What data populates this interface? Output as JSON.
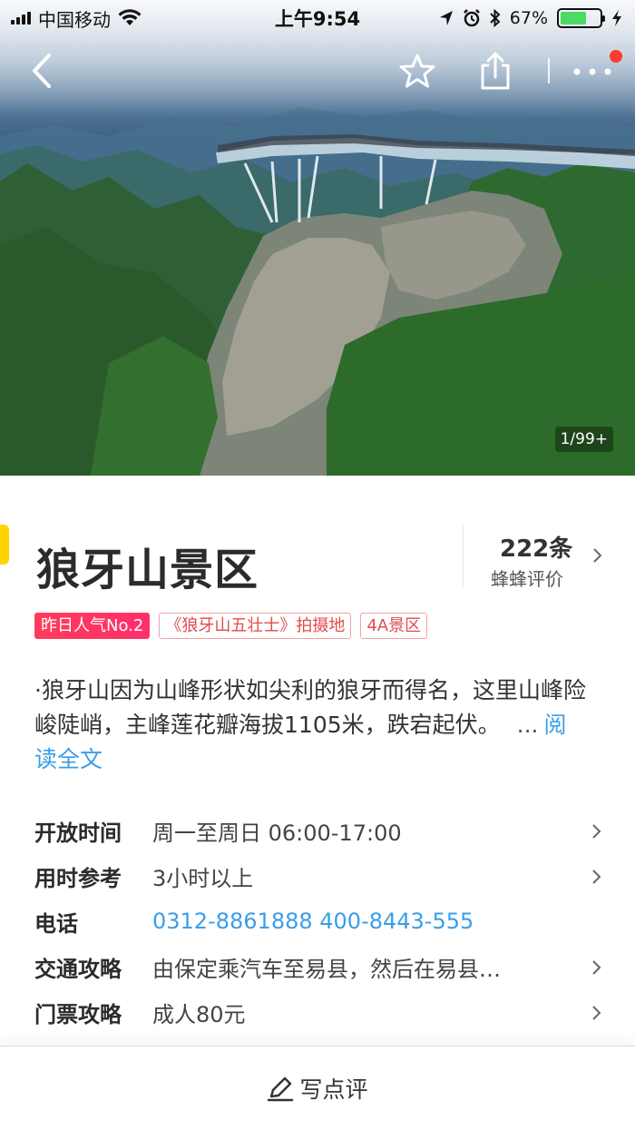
{
  "status_bar": {
    "carrier": "中国移动",
    "time": "上午9:54",
    "battery_percent": "67%",
    "battery_level": 0.67
  },
  "nav": {
    "back_icon": "chevron-left-icon",
    "favorite_icon": "star-icon",
    "share_icon": "share-icon",
    "more_icon": "more-dots-icon",
    "has_notification_dot": true
  },
  "hero": {
    "image_counter": "1/99+"
  },
  "poi": {
    "title": "狼牙山景区",
    "review_count": "222条",
    "review_label": "蜂蜂评价",
    "tags": [
      {
        "label": "昨日人气No.2",
        "style": "hot"
      },
      {
        "label": "《狼牙山五壮士》拍摄地",
        "style": "outline"
      },
      {
        "label": "4A景区",
        "style": "outline"
      }
    ],
    "description": "·狼牙山因为山峰形状如尖利的狼牙而得名，这里山峰险峻陡峭，主峰莲花瓣海拔1105米，跌宕起伏。",
    "description_ellipsis": "...",
    "read_more": "阅读全文"
  },
  "info": [
    {
      "key": "开放时间",
      "value": "周一至周日 06:00-17:00",
      "link": false,
      "chevron": true
    },
    {
      "key": "用时参考",
      "value": "3小时以上",
      "link": false,
      "chevron": true
    },
    {
      "key": "电话",
      "value": "0312-8861888 400-8443-555",
      "link": true,
      "chevron": false
    },
    {
      "key": "交通攻略",
      "value": "由保定乘汽车至易县，然后在易县…",
      "link": false,
      "chevron": true
    },
    {
      "key": "门票攻略",
      "value": "成人80元",
      "link": false,
      "chevron": true
    }
  ],
  "footer": {
    "icon": "pencil-icon",
    "label": "写点评"
  },
  "colors": {
    "accent_link": "#3a9ee6",
    "hot_tag": "#ff3b5a",
    "tag_outline_text": "#e34a4a",
    "side_mark": "#ffd400",
    "notification_dot": "#ff3b30"
  }
}
